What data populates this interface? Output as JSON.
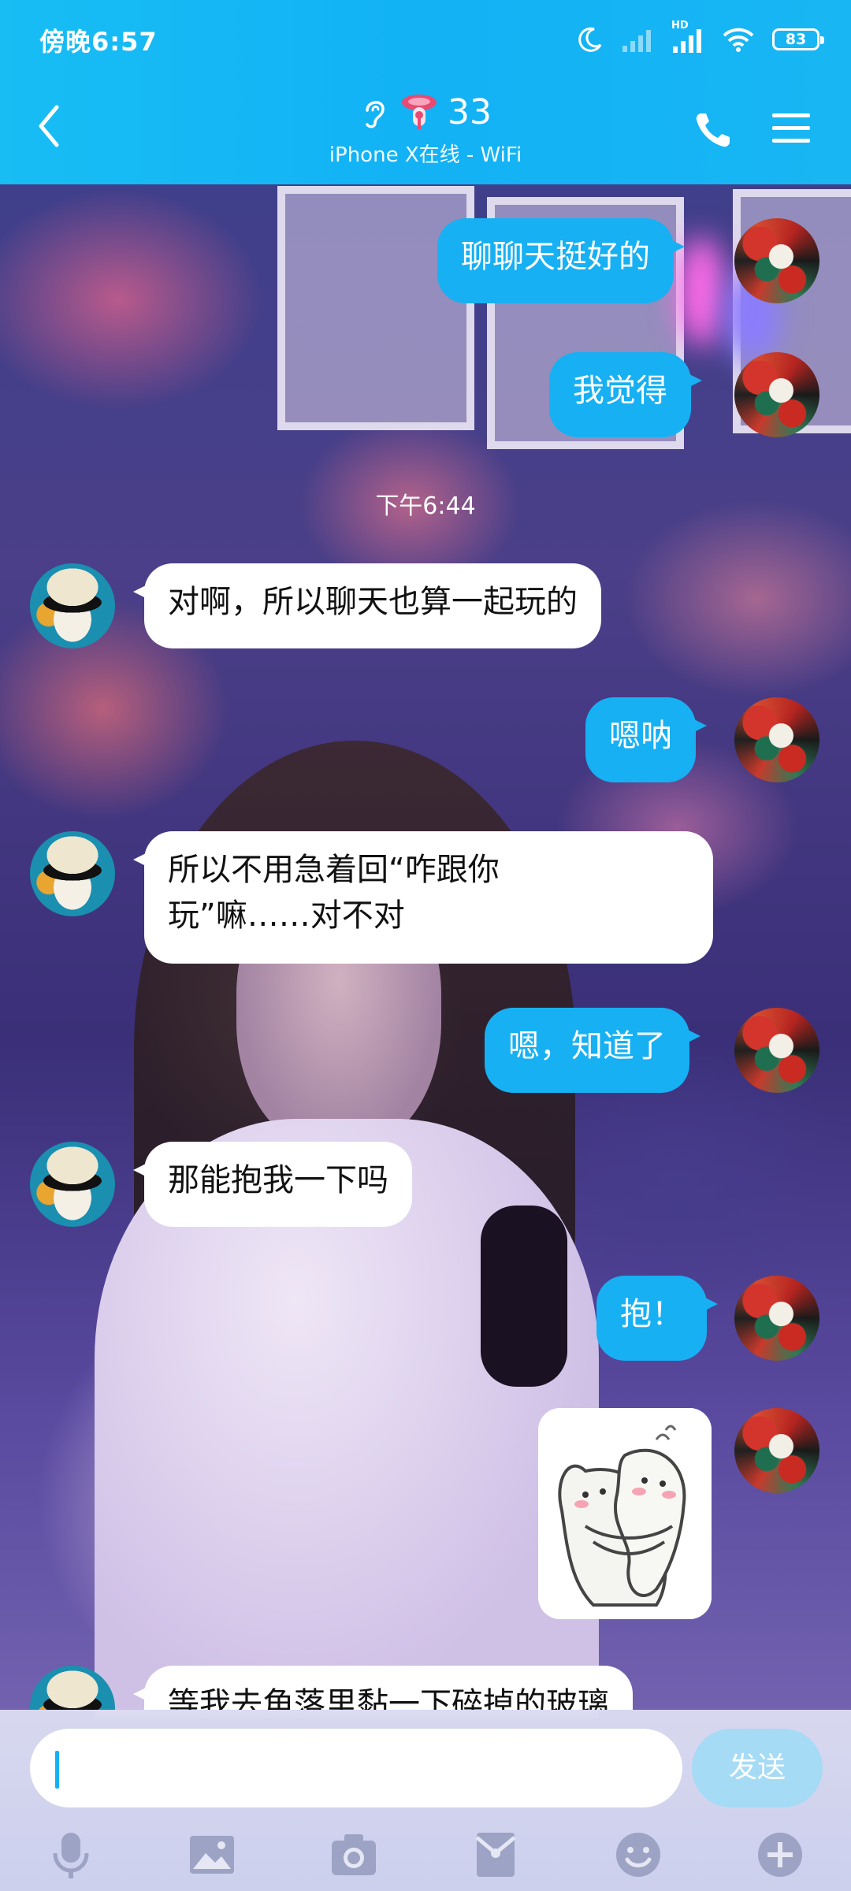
{
  "status_bar": {
    "time": "傍晚6:57",
    "network": "HD",
    "battery": "83"
  },
  "header": {
    "contact_name": "33",
    "device_status": "iPhone X在线 - WiFi",
    "icons": [
      "back-arrow-icon",
      "ear-icon",
      "pacifier-badge-icon",
      "phone-icon",
      "menu-icon"
    ]
  },
  "messages": [
    {
      "side": "me",
      "text": "聊聊天挺好的"
    },
    {
      "side": "me",
      "text": "我觉得"
    },
    {
      "type": "time",
      "text": "下午6:44"
    },
    {
      "side": "other",
      "text": "对啊，所以聊天也算一起玩的"
    },
    {
      "side": "me",
      "text": "嗯呐"
    },
    {
      "side": "other",
      "line1": "所以不用急着回“咋跟你",
      "line2": "玩”嘛……对不对"
    },
    {
      "side": "me",
      "text": "嗯，知道了"
    },
    {
      "side": "other",
      "text": "那能抱我一下吗"
    },
    {
      "side": "me",
      "text": "抱！"
    },
    {
      "side": "me",
      "type": "sticker",
      "sticker": "hug-sticker"
    },
    {
      "side": "other",
      "text": "等我去角落里黏一下碎掉的玻璃"
    }
  ],
  "input": {
    "placeholder": "",
    "send_label": "发送"
  },
  "toolbar": [
    "mic-icon",
    "image-icon",
    "camera-icon",
    "red-packet-icon",
    "emoji-icon",
    "plus-icon"
  ],
  "colors": {
    "accent": "#12b2f5",
    "my_bubble": "#17b0f3",
    "their_bubble": "#ffffff"
  }
}
